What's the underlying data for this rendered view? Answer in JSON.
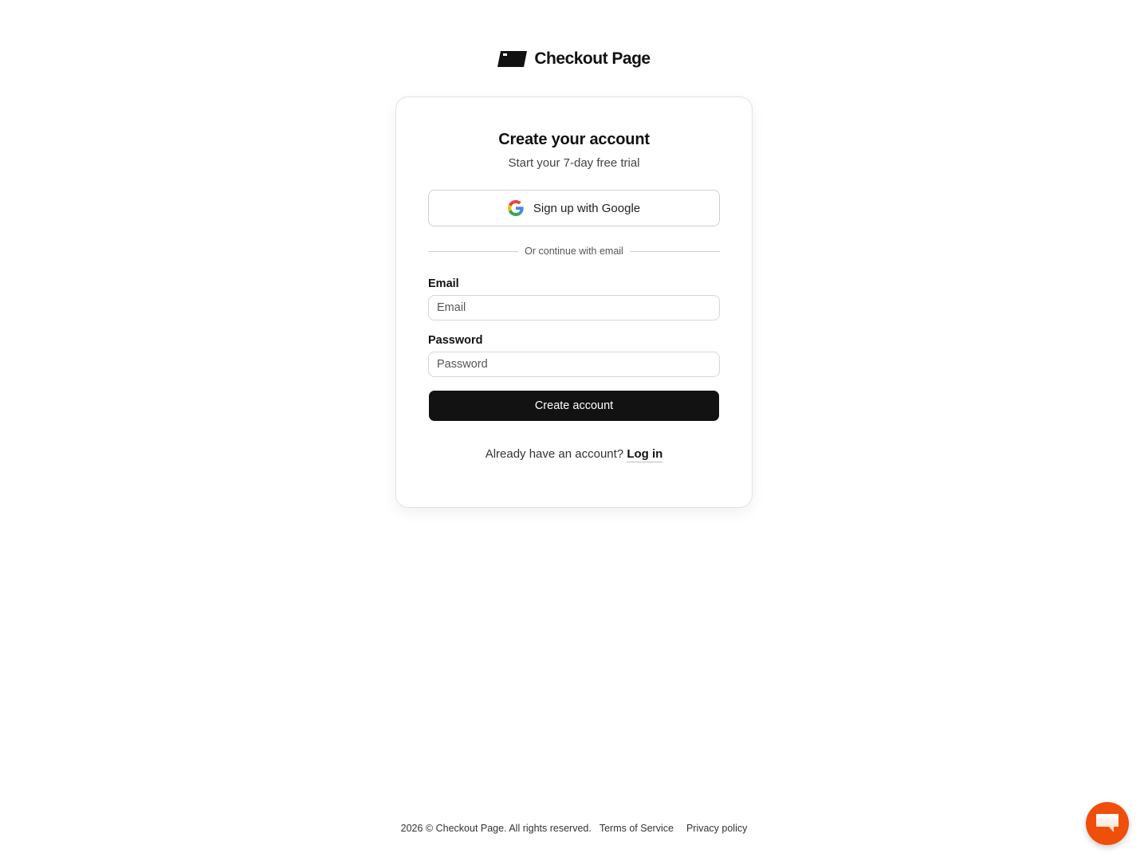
{
  "brand": {
    "name": "Checkout Page"
  },
  "card": {
    "title": "Create your account",
    "subtitle": "Start your 7-day free trial",
    "google_button_label": "Sign up with Google",
    "divider_text": "Or continue with email",
    "email": {
      "label": "Email",
      "placeholder": "Email",
      "value": ""
    },
    "password": {
      "label": "Password",
      "placeholder": "Password",
      "value": ""
    },
    "submit_label": "Create account",
    "login_prompt": "Already have an account?",
    "login_link": "Log in"
  },
  "footer": {
    "copyright": "2026 © Checkout Page. All rights reserved.",
    "links": [
      "Terms of Service",
      "Privacy policy"
    ]
  },
  "colors": {
    "primary_button": "#121212",
    "chat_accent": "#f04e0b"
  },
  "icons": {
    "brand": "parallelogram-logo-icon",
    "google": "google-g-icon",
    "chat": "chat-bubble-icon"
  }
}
